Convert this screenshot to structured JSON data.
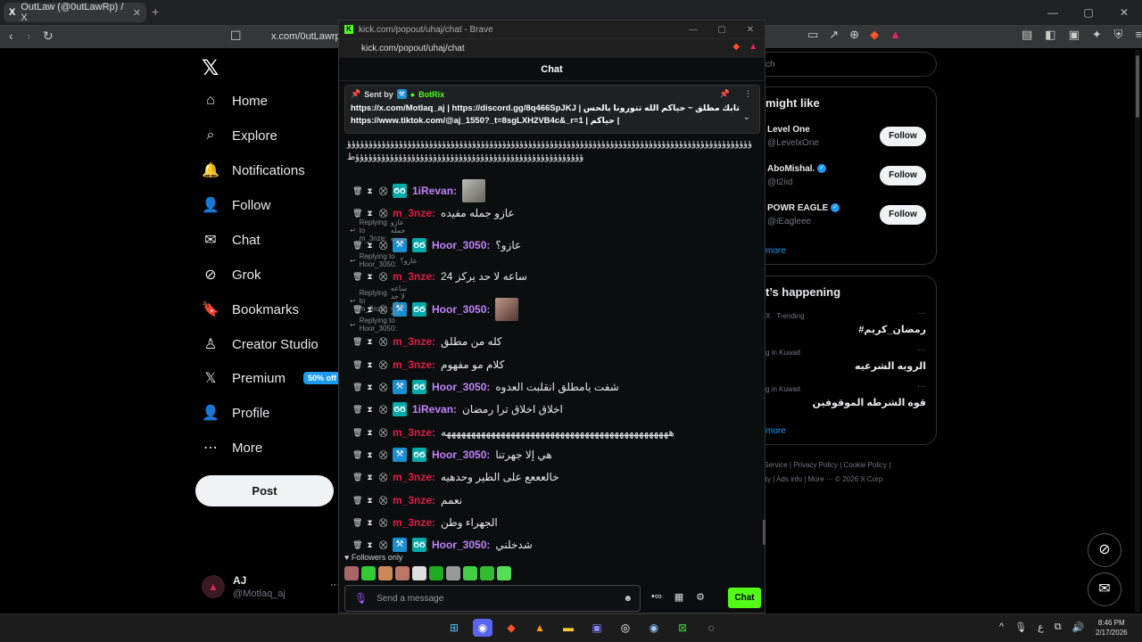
{
  "browser": {
    "tab_title": "OutLaw (@0utLawRp) / X",
    "tab_icon": "X",
    "new_tab": "+",
    "url": "x.com/0utLawrp",
    "win_min": "—",
    "win_max": "▢",
    "win_close": "✕"
  },
  "x": {
    "logo": "𝕏",
    "nav": [
      {
        "label": "Home",
        "icon": "⌂"
      },
      {
        "label": "Explore",
        "icon": "⌕"
      },
      {
        "label": "Notifications",
        "icon": "🔔"
      },
      {
        "label": "Follow",
        "icon": "👤"
      },
      {
        "label": "Chat",
        "icon": "✉"
      },
      {
        "label": "Grok",
        "icon": "⊘"
      },
      {
        "label": "Bookmarks",
        "icon": "🔖"
      },
      {
        "label": "Creator Studio",
        "icon": "♙"
      },
      {
        "label": "Premium",
        "icon": "𝕏"
      },
      {
        "label": "Profile",
        "icon": "👤"
      },
      {
        "label": "More",
        "icon": "⋯"
      }
    ],
    "premium_badge": "50% off",
    "post_button": "Post",
    "account": {
      "name": "AJ",
      "handle": "@Motlaq_aj",
      "avatar": "▲",
      "more": "···"
    }
  },
  "sidebar": {
    "search_placeholder": "ch",
    "who_to_follow_title": "might like",
    "follow_suggestions": [
      {
        "name": "Level One",
        "handle": "@LevelxOne",
        "verified": false,
        "button": "Follow"
      },
      {
        "name": "AboMishal.",
        "handle": "@t2iid",
        "verified": true,
        "button": "Follow"
      },
      {
        "name": "POWR EAGLE",
        "handle": "@iEagleee",
        "verified": true,
        "button": "Follow"
      }
    ],
    "show_more": "more",
    "happening_title": "t’s happening",
    "trends": [
      {
        "meta": "X · Trending",
        "name": "#رمضان_كريم"
      },
      {
        "meta": "g in Kuwait",
        "name": "الرويه الشرعيه"
      },
      {
        "meta": "g in Kuwait",
        "name": "قوه الشرطه الموقوفين"
      }
    ],
    "show_more_2": "more",
    "footer_line1": "Service  |  Privacy Policy  |  Cookie Policy  |",
    "footer_line2": "ity  |  Ads info  |  More ···  © 2026 X Corp.",
    "verified_mark": "✓"
  },
  "popup": {
    "title": "kick.com/popout/uhaj/chat - Brave",
    "url": "kick.com/popout/uhaj/chat",
    "chat_header": "Chat",
    "pinned": {
      "sent_by_label": "Sent by",
      "bot": "BotRix",
      "text": "تابك مطلق ~ حياكم الله تتورونا بالحس | https://x.com/Motlaq_aj | https://discord.gg/8q466SpJKJ | حياكم | https://www.tiktok.com/@aj_1550?_t=8sgLXH2VB4c&_r=1",
      "pin_icon": "📌",
      "menu_icon": "⋮",
      "chevron": "⌄"
    },
    "spam_text": "ؤؤؤؤؤؤؤؤؤؤؤؤؤؤؤؤؤؤؤؤؤؤؤؤؤؤؤؤؤؤؤؤؤؤؤؤؤؤؤؤؤؤؤؤؤؤؤؤؤؤؤؤؤؤؤؤؤؤؤؤؤؤؤؤؤؤؤؤؤؤؤؤؤؤؤؤؤؤؤؤؤؤؤؤؤؤؤؤؤؤؤؤؤؤؤؤؤؤؤؤؤؤؤؤؤؤؤؤؤؤؤؤؤؤؤؤؤؤؤؤؤؤؤؤؤؤؤؤؤؤؤؤؤؤؤؤؤؤؤؤؤؤؤؤؤؤؤط",
    "messages": [
      {
        "user": "1iRevan:",
        "text": "",
        "color": "#c084fc"
      },
      {
        "user": "m_3nze:",
        "text": "عازو جمله مفيده",
        "color": "#e11d48"
      },
      {
        "user": "Hoor_3050:",
        "text": "عازو؟",
        "color": "#c084fc"
      },
      {
        "user": "m_3nze:",
        "text": "ساعه لا حد يركز 24",
        "color": "#e11d48"
      },
      {
        "user": "Hoor_3050:",
        "text": "",
        "color": "#c084fc"
      },
      {
        "user": "m_3nze:",
        "text": "كله من مطلق",
        "color": "#e11d48"
      },
      {
        "user": "m_3nze:",
        "text": "كلام مو مفهوم",
        "color": "#e11d48"
      },
      {
        "user": "Hoor_3050:",
        "text": "شفت يامطلق انقلبت العدوه",
        "color": "#c084fc"
      },
      {
        "user": "1iRevan:",
        "text": "اخلاق اخلاق ترا رمضان",
        "color": "#c084fc"
      },
      {
        "user": "m_3nze:",
        "text": "ههههههههههههههههههههههههههههههههههههههههههههههه",
        "color": "#e11d48"
      },
      {
        "user": "Hoor_3050:",
        "text": "هي إلا جهرتنا",
        "color": "#c084fc"
      },
      {
        "user": "m_3nze:",
        "text": "خالعععع على الطير وحدهيه",
        "color": "#e11d48"
      },
      {
        "user": "m_3nze:",
        "text": "نعمم",
        "color": "#e11d48"
      },
      {
        "user": "m_3nze:",
        "text": "الجهراء وطن",
        "color": "#e11d48"
      },
      {
        "user": "Hoor_3050:",
        "text": "شدخلني",
        "color": "#c084fc"
      }
    ],
    "replies": [
      {
        "to": "Replying to m_3nze:",
        "quote": "عازو جمله مفيده"
      },
      {
        "to": "Replying to Hoor_3050:",
        "quote": "عازو؟"
      },
      {
        "to": "Replying to m_3nze:",
        "quote": "ساعه لا حد يركز 24"
      },
      {
        "to": "Replying to Hoor_3050:",
        "quote": ""
      }
    ],
    "followers_only": "Followers only",
    "input_placeholder": "Send a message",
    "chat_button": "Chat"
  },
  "taskbar": {
    "time": "8:46 PM",
    "date": "2/17/2026",
    "lang": "ع"
  }
}
